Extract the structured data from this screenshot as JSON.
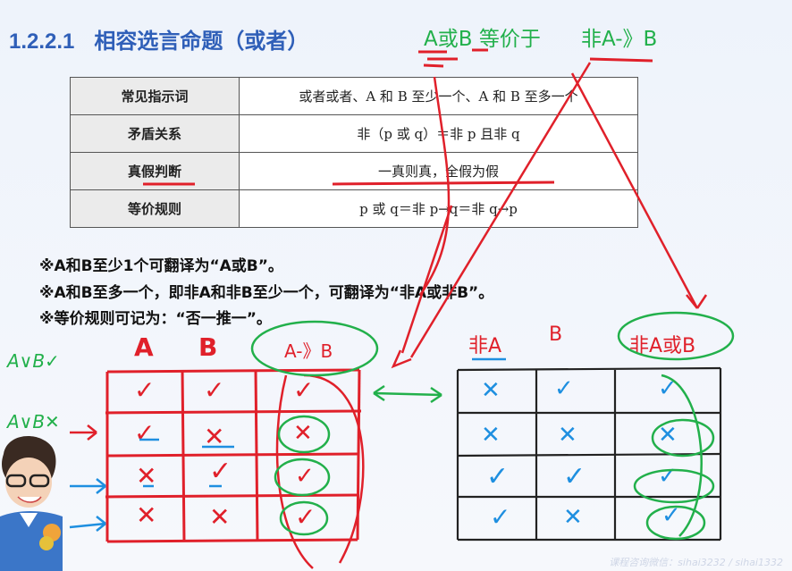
{
  "slide": {
    "section_number": "1.2.2.1",
    "title": "相容选言命题（或者）",
    "annotation_top": "A或B 等价于",
    "annotation_top_2": "非A-》B"
  },
  "table": {
    "rows": [
      {
        "key": "常见指示词",
        "value": "或者或者、A 和 B 至少一个、A 和 B 至多一个"
      },
      {
        "key": "矛盾关系",
        "value": "非（p 或 q）＝非 p 且非 q"
      },
      {
        "key": "真假判断",
        "value": "一真则真，全假为假"
      },
      {
        "key": "等价规则",
        "value": "p 或 q＝非 p→q＝非 q→p"
      }
    ]
  },
  "notes": [
    "※A和B至少1个可翻译为“A或B”。",
    "※A和B至多一个，即非A和非B至少一个，可翻译为“非A或非B”。",
    "※等价规则可记为：“否一推一”。"
  ],
  "left_grid": {
    "headers": [
      "A",
      "B",
      "A-》B"
    ],
    "rows": [
      [
        "✓",
        "✓",
        "✓"
      ],
      [
        "✓",
        "✕",
        "✕"
      ],
      [
        "✕",
        "✓",
        "✓"
      ],
      [
        "✕",
        "✕",
        "✓"
      ]
    ]
  },
  "right_grid": {
    "headers": [
      "非A",
      "B",
      "非A或B"
    ],
    "rows": [
      [
        "✕",
        "✓",
        "✓"
      ],
      [
        "✕",
        "✕",
        "✕"
      ],
      [
        "✓",
        "✓",
        "✓"
      ],
      [
        "✓",
        "✕",
        "✓"
      ]
    ]
  },
  "side_marks": [
    "A∨B✓",
    "A∨B✕"
  ],
  "footer": "课程咨询微信：sihai3232 / sihai1332",
  "colors": {
    "title": "#2f5fb8",
    "green": "#22b04b",
    "red": "#e0202a",
    "blue": "#1e8fe0"
  }
}
